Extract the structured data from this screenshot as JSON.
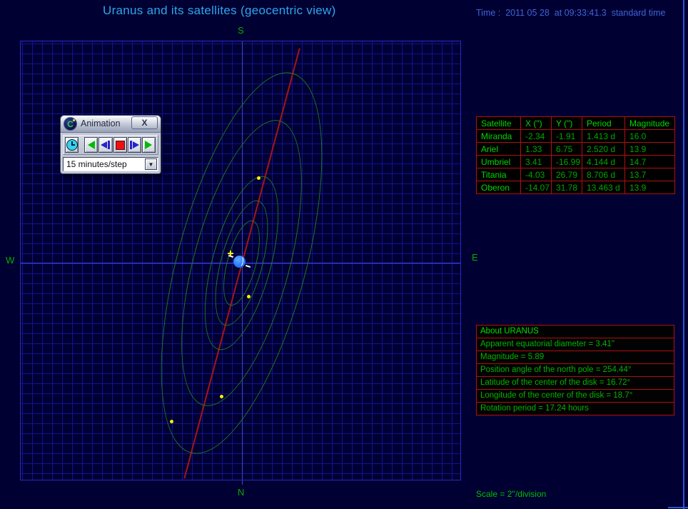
{
  "header": {
    "title": "Uranus and its satellites (geocentric view)",
    "time": "Time :  2011 05 28  at 09:33:41.3  standard time"
  },
  "plot": {
    "labels": {
      "south": "S",
      "north": "N",
      "west": "W",
      "east": "E"
    },
    "scale_label": "Scale = 2''/division",
    "grid_division_arcsec": "2",
    "objects": [
      "Uranus",
      "Miranda",
      "Ariel",
      "Umbriel",
      "Titania",
      "Oberon"
    ]
  },
  "animation_dialog": {
    "title": "Animation",
    "close_glyph": "X",
    "toolbar_buttons": [
      "real-time-clock",
      "play-backward",
      "step-backward",
      "stop",
      "step-forward",
      "play-forward"
    ],
    "step_selector": {
      "value": "15 minutes/step",
      "dropdown_arrow": "▼"
    }
  },
  "satellite_table": {
    "headers": [
      "Satellite",
      "X (\")",
      "Y (\")",
      "Period",
      "Magnitude"
    ],
    "rows": [
      [
        "Miranda",
        "-2.34",
        "-1.91",
        "1.413 d",
        "16.0"
      ],
      [
        "Ariel",
        "1.33",
        "6.75",
        "2.520 d",
        "13.9"
      ],
      [
        "Umbriel",
        "3.41",
        "-16.99",
        "4.144 d",
        "14.7"
      ],
      [
        "Titania",
        "-4.03",
        "26.79",
        "8.706 d",
        "13.7"
      ],
      [
        "Oberon",
        "-14.07",
        "31.78",
        "13.463 d",
        "13.9"
      ]
    ]
  },
  "about_panel": {
    "title": "About URANUS",
    "lines": [
      "Apparent equatorial diameter = 3.41''",
      "Magnitude = 5.89",
      "Position angle of the north pole = 254.44°",
      "Latitude of the center of the disk = 16.72°",
      "Longitude of the center of the disk = 18.7°",
      "Rotation period = 17.24 hours"
    ]
  },
  "colors": {
    "background": "#000032",
    "grid": "#11119c",
    "axis": "#3946d6",
    "orbit": "#1d7a1d",
    "rotation_axis": "#a81414",
    "satellite": "#ffee00",
    "uranus": "#2b7cf7",
    "table_border": "#b01010",
    "table_text": "#00c000",
    "title_text": "#2ca6f0",
    "time_text": "#3f63da"
  }
}
